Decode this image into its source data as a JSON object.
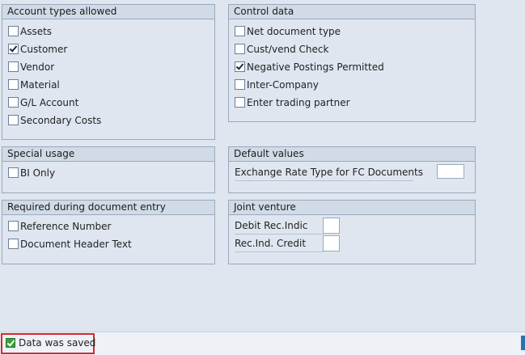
{
  "groups": {
    "account_types": {
      "title": "Account types allowed",
      "items": [
        {
          "label": "Assets",
          "checked": false
        },
        {
          "label": "Customer",
          "checked": true
        },
        {
          "label": "Vendor",
          "checked": false
        },
        {
          "label": "Material",
          "checked": false
        },
        {
          "label": "G/L Account",
          "checked": false
        },
        {
          "label": "Secondary Costs",
          "checked": false
        }
      ]
    },
    "control_data": {
      "title": "Control data",
      "items": [
        {
          "label": "Net document type",
          "checked": false
        },
        {
          "label": "Cust/vend Check",
          "checked": false
        },
        {
          "label": "Negative Postings Permitted",
          "checked": true
        },
        {
          "label": "Inter-Company",
          "checked": false
        },
        {
          "label": "Enter trading partner",
          "checked": false
        }
      ]
    },
    "special_usage": {
      "title": "Special usage",
      "items": [
        {
          "label": "BI Only",
          "checked": false
        }
      ]
    },
    "default_values": {
      "title": "Default values",
      "field_label": "Exchange Rate Type for FC Documents",
      "field_value": ""
    },
    "required_entry": {
      "title": "Required during document entry",
      "items": [
        {
          "label": "Reference Number",
          "checked": false
        },
        {
          "label": "Document Header Text",
          "checked": false
        }
      ]
    },
    "joint_venture": {
      "title": "Joint venture",
      "fields": [
        {
          "label": "Debit Rec.Indic",
          "value": ""
        },
        {
          "label": "Rec.Ind. Credit",
          "value": ""
        }
      ]
    }
  },
  "status": {
    "message": "Data was saved",
    "type": "success"
  }
}
